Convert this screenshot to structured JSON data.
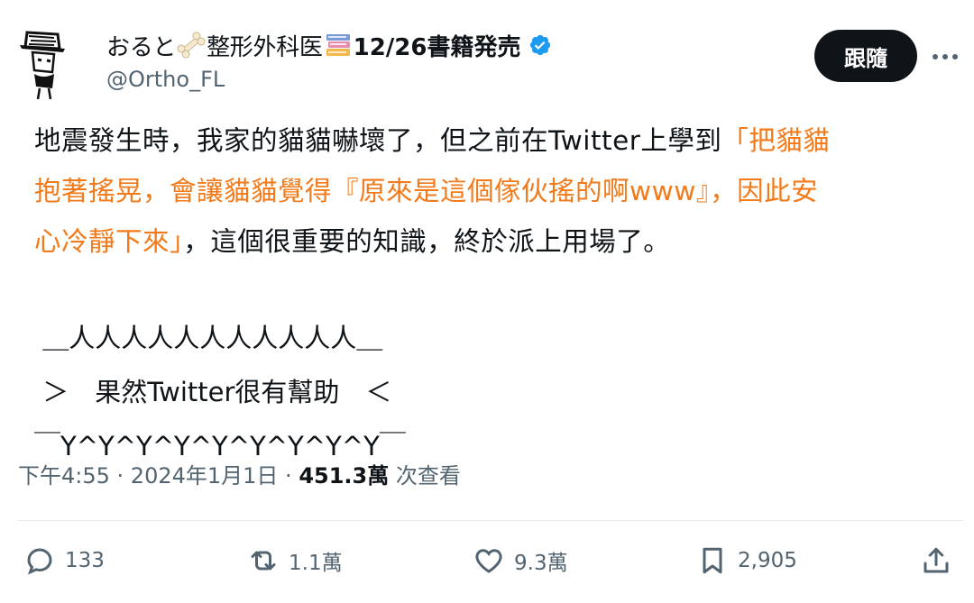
{
  "author": {
    "display_name": "おると",
    "name_suffix": "整形外科医",
    "book_release": "12/26書籍発売",
    "handle": "@Ortho_FL",
    "verified_icon": "verified-badge-icon",
    "follow_label": "跟隨"
  },
  "tweet": {
    "line1_a": "地震發生時，我家的貓貓嚇壞了，但之前在Twitter上學到",
    "line1_b": "「把貓貓",
    "line2": "抱著搖晃，會讓貓貓覺得『原來是這個傢伙搖的啊www』，因此安",
    "line3_a": "心冷靜下來」",
    "line3_b": "，這個很重要的知識，終於派上用場了。",
    "ascii_top": " ＿人人人人人人人人人人人＿",
    "ascii_mid": " ＞　果然Twitter很有幫助　＜",
    "ascii_bot": "￣Y^Y^Y^Y^Y^Y^Y^Y^Y￣",
    "highlight_color": "#f27a1a"
  },
  "meta": {
    "time": "下午4:55",
    "sep1": " · ",
    "date": "2024年1月1日",
    "sep2": " · ",
    "views": "451.3萬",
    "views_label": " 次查看"
  },
  "actions": {
    "reply_count": "133",
    "retweet_count": "1.1萬",
    "like_count": "9.3萬",
    "bookmark_count": "2,905"
  }
}
